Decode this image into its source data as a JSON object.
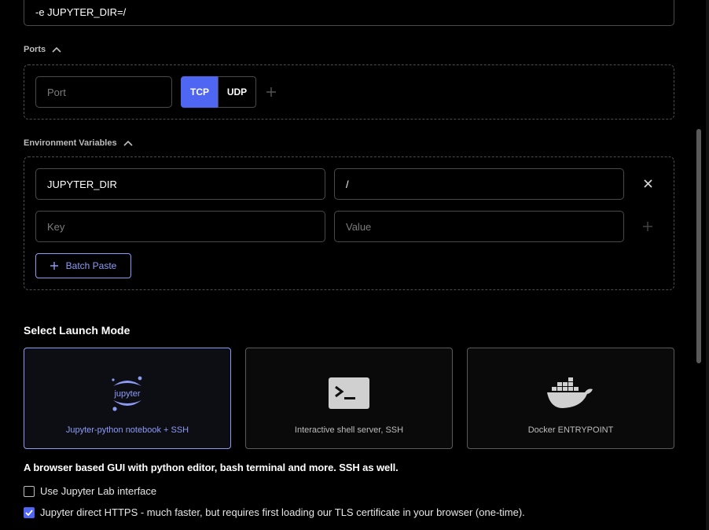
{
  "docker_options": {
    "value": "-e JUPYTER_DIR=/"
  },
  "ports": {
    "label": "Ports",
    "port_placeholder": "Port",
    "tcp_label": "TCP",
    "udp_label": "UDP",
    "selected_protocol": "TCP",
    "add_icon": "plus-icon"
  },
  "env": {
    "label": "Environment Variables",
    "rows": [
      {
        "key": "JUPYTER_DIR",
        "value": "/"
      }
    ],
    "key_placeholder": "Key",
    "value_placeholder": "Value",
    "batch_paste_label": "Batch Paste"
  },
  "launch": {
    "title": "Select Launch Mode",
    "modes": [
      {
        "label": "Jupyter-python notebook + SSH",
        "icon": "jupyter-logo",
        "selected": true
      },
      {
        "label": "Interactive shell server, SSH",
        "icon": "terminal-icon",
        "selected": false
      },
      {
        "label": "Docker ENTRYPOINT",
        "icon": "docker-logo",
        "selected": false
      }
    ],
    "jupyter_logo_text": "jupyter",
    "description": "A browser based GUI with python editor, bash terminal and more. SSH as well.",
    "options": [
      {
        "label": "Use Jupyter Lab interface",
        "checked": false
      },
      {
        "label": "Jupyter direct HTTPS - much faster, but requires first loading our TLS certificate in your browser (one-time).",
        "checked": true
      }
    ]
  },
  "colors": {
    "accent": "#4f66f2",
    "selected_border": "#8e9bf5",
    "background": "#000000"
  }
}
